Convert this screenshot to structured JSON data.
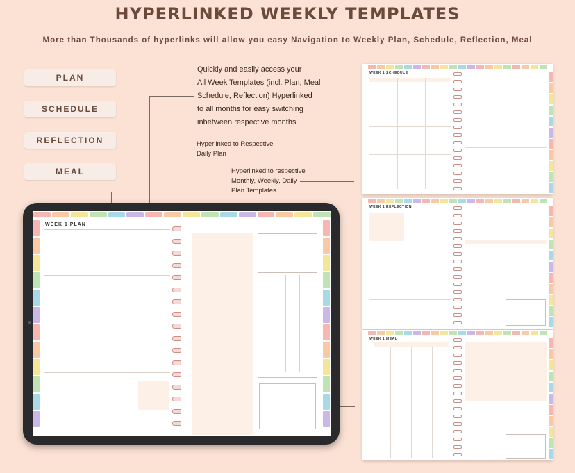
{
  "header": {
    "title": "HYPERLINKED WEEKLY TEMPLATES",
    "subtitle": "More than Thousands of hyperlinks will allow you easy Navigation to Weekly Plan, Schedule, Reflection, Meal"
  },
  "nav_buttons": [
    {
      "label": "PLAN"
    },
    {
      "label": "SCHEDULE"
    },
    {
      "label": "REFLECTION"
    },
    {
      "label": "MEAL"
    }
  ],
  "callouts": {
    "access_lines": [
      "Quickly and easily access your",
      "All Week Templates (incl. Plan, Meal",
      "Schedule, Reflection) Hyperlinked",
      "to all months for easy switching",
      "inbetween respective months"
    ],
    "daily_lines": [
      "Hyperlinked to Respective",
      "Daily Plan"
    ],
    "monthly_lines": [
      "Hyperlinked to respective",
      "Monthly, Weekly, Daily",
      "Plan Templates"
    ]
  },
  "tablet": {
    "page_title": "WEEK 1 PLAN",
    "tab_colors": [
      "#f6b7b3",
      "#f8c9a4",
      "#f3e59a",
      "#bfe3b4",
      "#a9d8e6",
      "#c9b8e8",
      "#f6b7b3",
      "#f8c9a4",
      "#f3e59a",
      "#bfe3b4",
      "#a9d8e6",
      "#c9b8e8",
      "#f6b7b3",
      "#f8c9a4",
      "#f3e59a",
      "#bfe3b4"
    ]
  },
  "preview_cards": [
    {
      "title": "WEEK 1 SCHEDULE"
    },
    {
      "title": "WEEK 1 REFLECTION"
    },
    {
      "title": "WEEK 1 MEAL"
    }
  ],
  "colors": {
    "background": "#fbe2d4",
    "text_brown": "#6b4a3a",
    "accent_peach": "#fdf0e6"
  }
}
